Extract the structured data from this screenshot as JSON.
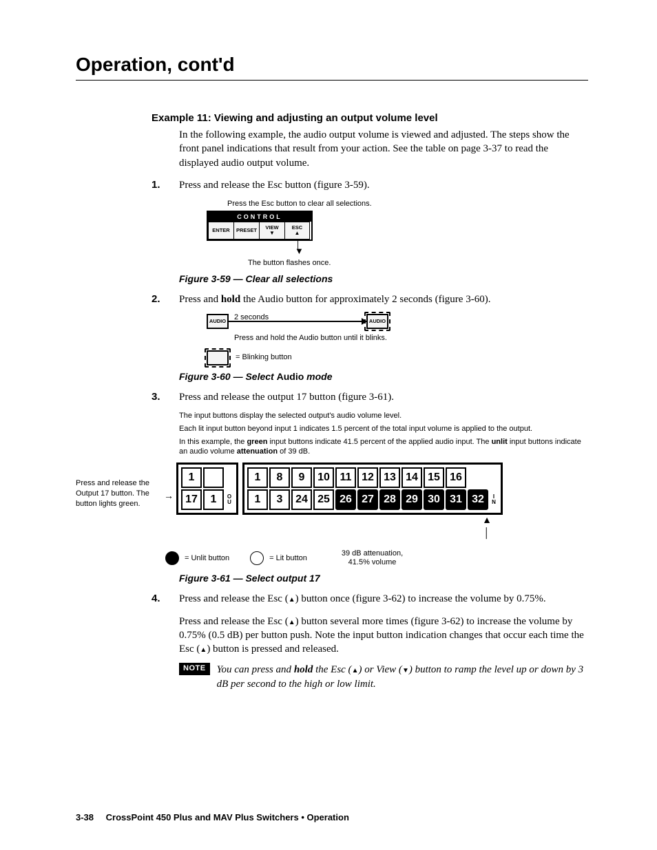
{
  "chapter_title": "Operation, cont'd",
  "example": {
    "heading": "Example 11: Viewing and adjusting an output volume level",
    "intro": "In the following example, the audio output volume is viewed and adjusted.  The steps show the front panel indications that result from your action.  See the table on page 3-37 to read the displayed audio output volume."
  },
  "steps": {
    "s1": {
      "num": "1.",
      "text": "Press and release the Esc button (figure 3-59)."
    },
    "s2": {
      "num": "2.",
      "pre": "Press and ",
      "bold": "hold",
      "post": " the Audio button for approximately 2 seconds (figure 3-60)."
    },
    "s3": {
      "num": "3.",
      "text": "Press and release the output 17 button (figure 3-61)."
    },
    "s4": {
      "num": "4.",
      "p1_a": "Press and release the Esc (",
      "p1_b": ") button once (figure 3-62) to increase the volume by 0.75%.",
      "p2_a": "Press and release the Esc (",
      "p2_b": ") button several more times (figure 3-62) to increase the volume by 0.75% (0.5 dB) per button push.  Note the input button indication changes that occur each time the Esc (",
      "p2_c": ") button is pressed and released."
    }
  },
  "fig59": {
    "top_label": "Press the Esc button to clear all selections.",
    "panel_title": "CONTROL",
    "btn_enter": "ENTER",
    "btn_preset": "PRESET",
    "btn_view": "VIEW",
    "btn_esc": "ESC",
    "bottom_label": "The button flashes once.",
    "caption": "Figure 3-59 — Clear all selections"
  },
  "fig60": {
    "audio": "AUDIO",
    "two_seconds": "2 seconds",
    "below": "Press and hold the Audio button until it blinks.",
    "legend": " = Blinking button",
    "caption_pre": "Figure 3-60 — Select ",
    "caption_bold": "Audio",
    "caption_post": " mode"
  },
  "fig61": {
    "explain1": "The input buttons display the selected output's audio volume level.",
    "explain2": "Each lit input button beyond input 1 indicates 1.5 percent of the total input volume is applied to the output.",
    "explain3_a": "In this example, the ",
    "explain3_green": "green",
    "explain3_b": " input buttons indicate 41.5 percent of the applied audio input.  The ",
    "explain3_unlit": "unlit",
    "explain3_c": " input buttons indicate an audio volume ",
    "explain3_att": "attenuation",
    "explain3_d": " of 39 dB.",
    "side": "Press and release the Output 17 button.  The button lights green.",
    "left_top": [
      "1",
      ""
    ],
    "left_bot": [
      "17",
      "1"
    ],
    "io_left": "O U",
    "right_top": [
      "1",
      "8",
      "9",
      "10",
      "11",
      "12",
      "13",
      "14",
      "15",
      "16"
    ],
    "right_bot": [
      "1",
      "3",
      "24",
      "25",
      "26",
      "27",
      "28",
      "29",
      "30",
      "31",
      "32"
    ],
    "io_right": "I N",
    "legend_unlit": "= Unlit button",
    "legend_lit": "= Lit button",
    "att_line1": "39 dB attenuation,",
    "att_line2": "41.5% volume",
    "caption": "Figure 3-61 — Select output 17"
  },
  "note": {
    "badge": "NOTE",
    "a": "You can press and ",
    "hold": "hold",
    "b": " the Esc (",
    "c": ") or View (",
    "d": ") button to ramp the level up or down by 3 dB per second to the high or low limit."
  },
  "footer": {
    "page": "3-38",
    "text": "CrossPoint 450 Plus and MAV Plus Switchers • Operation"
  }
}
